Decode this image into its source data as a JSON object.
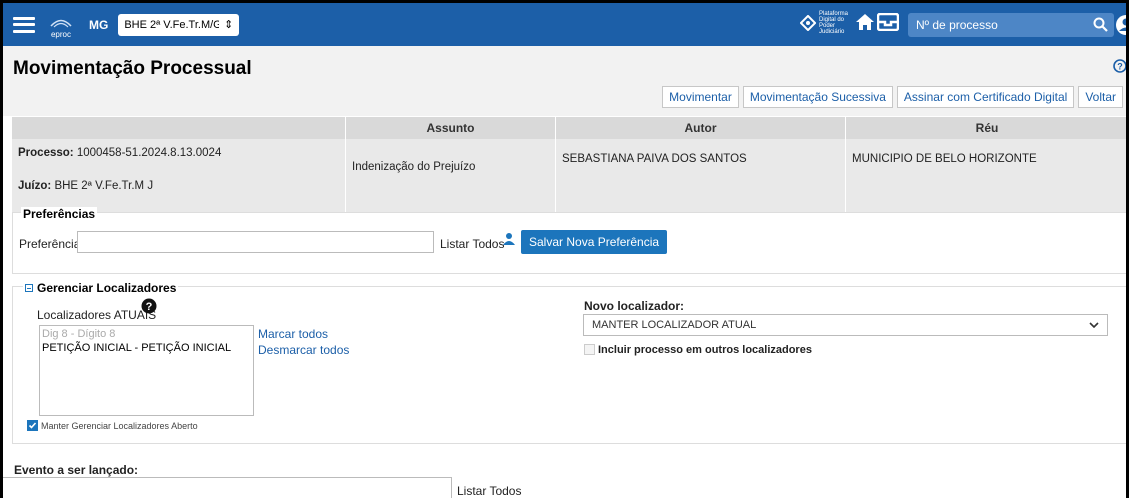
{
  "topbar": {
    "eproc_text": "eproc",
    "uf": "MG",
    "org_selected": "BHE 2ª V.Fe.Tr.M/GEF",
    "pdpj_text": "Plataforma Digital do Poder Judiciário",
    "search_placeholder": "Nº de processo"
  },
  "page": {
    "title": "Movimentação Processual"
  },
  "buttons": {
    "movimentar": "Movimentar",
    "sucessiva": "Movimentação Sucessiva",
    "assinar": "Assinar com Certificado Digital",
    "voltar": "Voltar"
  },
  "process_table": {
    "headers": [
      "",
      "Assunto",
      "Autor",
      "Réu"
    ],
    "processo_label": "Processo:",
    "processo_value": "1000458-51.2024.8.13.0024",
    "juizo_label": "Juízo:",
    "juizo_value": "BHE 2ª V.Fe.Tr.M J",
    "assunto": "Indenização do Prejuízo",
    "autor": "SEBASTIANA PAIVA DOS SANTOS",
    "reu": "MUNICIPIO DE BELO HORIZONTE"
  },
  "preferencias": {
    "legend": "Preferências",
    "label": "Preferência:",
    "input_value": "",
    "listar_todos": "Listar Todos",
    "salvar": "Salvar Nova Preferência"
  },
  "localizadores": {
    "legend": "Gerenciar Localizadores",
    "atuais_label": "Localizadores ATUAIS",
    "list_items": [
      "Dig 8 - Dígito 8",
      "PETIÇÃO INICIAL - PETIÇÃO INICIAL"
    ],
    "marcar_todos": "Marcar todos",
    "desmarcar_todos": "Desmarcar todos",
    "novo_label": "Novo localizador:",
    "novo_selected": "MANTER LOCALIZADOR ATUAL",
    "incluir_label": "Incluir processo em outros localizadores",
    "manter_aberto_label": "Manter Gerenciar Localizadores Aberto"
  },
  "evento": {
    "label": "Evento a ser lançado:",
    "input_value": "",
    "listar_todos": "Listar Todos"
  },
  "colors": {
    "topbar": "#1c5fa8",
    "primary": "#1c75bc",
    "link": "#1c5fa8"
  }
}
